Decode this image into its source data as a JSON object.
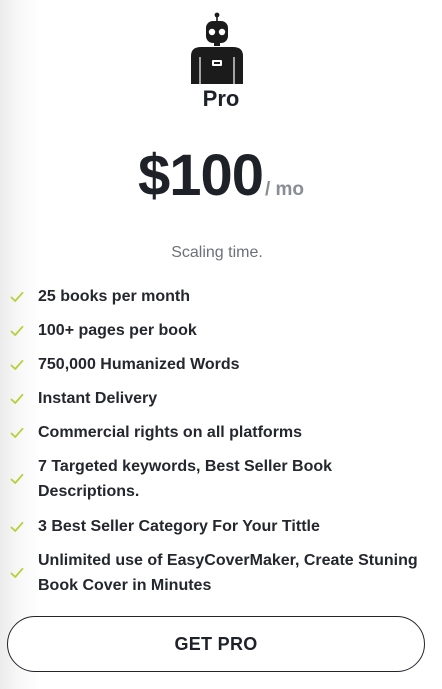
{
  "plan": {
    "icon": "robot-icon",
    "name": "Pro",
    "price": "$100",
    "period": "/ mo",
    "tagline": "Scaling time."
  },
  "features": [
    {
      "icon": "check-icon",
      "text": "25 books per month"
    },
    {
      "icon": "check-icon",
      "text": "100+ pages per book"
    },
    {
      "icon": "check-icon",
      "text": "750,000 Humanized Words"
    },
    {
      "icon": "check-icon",
      "text": "Instant Delivery"
    },
    {
      "icon": "check-icon",
      "text": "Commercial rights on all platforms"
    },
    {
      "icon": "check-icon",
      "text": "7 Targeted keywords, Best Seller Book Descriptions."
    },
    {
      "icon": "check-icon",
      "text": "3 Best Seller Category For Your Tittle"
    },
    {
      "icon": "check-icon",
      "text": "Unlimited use of EasyCoverMaker, Create Stuning Book Cover in Minutes"
    }
  ],
  "cta": {
    "label": "GET PRO"
  },
  "colors": {
    "check": "#b5d13a",
    "text": "#1f2128",
    "muted": "#8a8d94"
  }
}
